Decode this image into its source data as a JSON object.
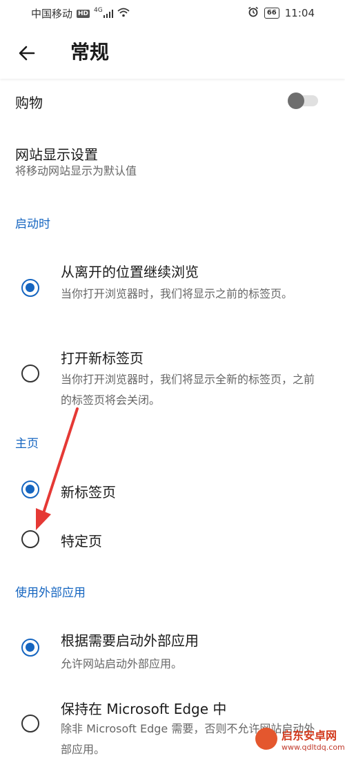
{
  "status_bar": {
    "carrier": "中国移动",
    "hd": "HD",
    "signal_gen": "4G",
    "battery": "66",
    "time": "11:04"
  },
  "app_bar": {
    "title": "常规"
  },
  "shopping": {
    "label": "购物",
    "enabled": false
  },
  "site_display": {
    "title": "网站显示设置",
    "subtitle": "将移动网站显示为默认值"
  },
  "sections": {
    "startup": {
      "header": "启动时",
      "options": [
        {
          "title": "从离开的位置继续浏览",
          "desc": "当你打开浏览器时，我们将显示之前的标签页。",
          "checked": true
        },
        {
          "title": "打开新标签页",
          "desc": "当你打开浏览器时，我们将显示全新的标签页，之前的标签页将会关闭。",
          "checked": false
        }
      ]
    },
    "home": {
      "header": "主页",
      "options": [
        {
          "title": "新标签页",
          "checked": true
        },
        {
          "title": "特定页",
          "checked": false
        }
      ]
    },
    "external": {
      "header": "使用外部应用",
      "options": [
        {
          "title": "根据需要启动外部应用",
          "desc": "允许网站启动外部应用。",
          "checked": true
        },
        {
          "title": "保持在 Microsoft Edge 中",
          "desc": "除非 Microsoft Edge 需要，否则不允许网站启动外部应用。",
          "checked": false
        }
      ]
    }
  },
  "colors": {
    "accent": "#1565c0",
    "annotation_arrow": "#e53935"
  },
  "watermark": {
    "name": "启东安卓网",
    "url": "www.qdltdq.com"
  }
}
